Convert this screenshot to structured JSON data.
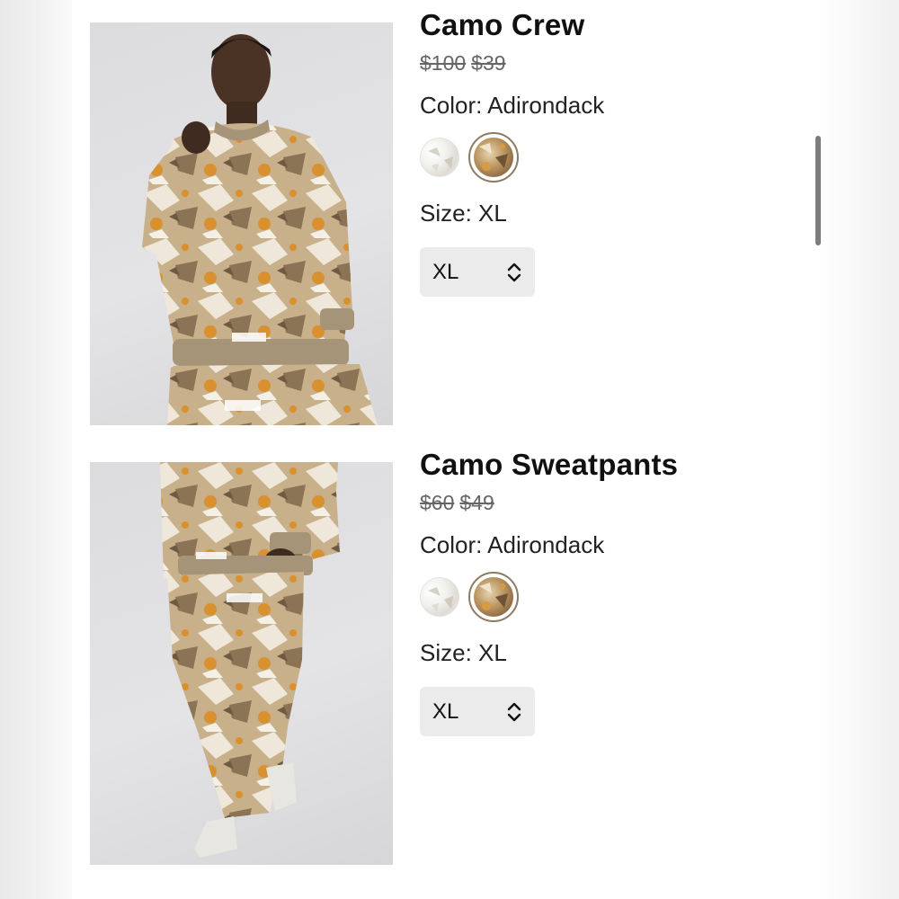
{
  "products": [
    {
      "title": "Camo Crew",
      "original_price": "$100",
      "sale_price": "$39",
      "color_label": "Color: Adirondack",
      "swatches": [
        "white-camo",
        "adirondack-camo"
      ],
      "selected_swatch": "adirondack-camo",
      "size_label": "Size: XL",
      "size_value": "XL"
    },
    {
      "title": "Camo Sweatpants",
      "original_price": "$60",
      "sale_price": "$49",
      "color_label": "Color: Adirondack",
      "swatches": [
        "white-camo",
        "adirondack-camo"
      ],
      "selected_swatch": "adirondack-camo",
      "size_label": "Size: XL",
      "size_value": "XL"
    }
  ],
  "colors": {
    "camo_base": "#c8b08a",
    "camo_dark": "#8b7355",
    "camo_accent": "#d9902f",
    "camo_light": "#efe8da",
    "select_bg": "#ebebeb",
    "scrollbar": "#7c7c7c"
  }
}
